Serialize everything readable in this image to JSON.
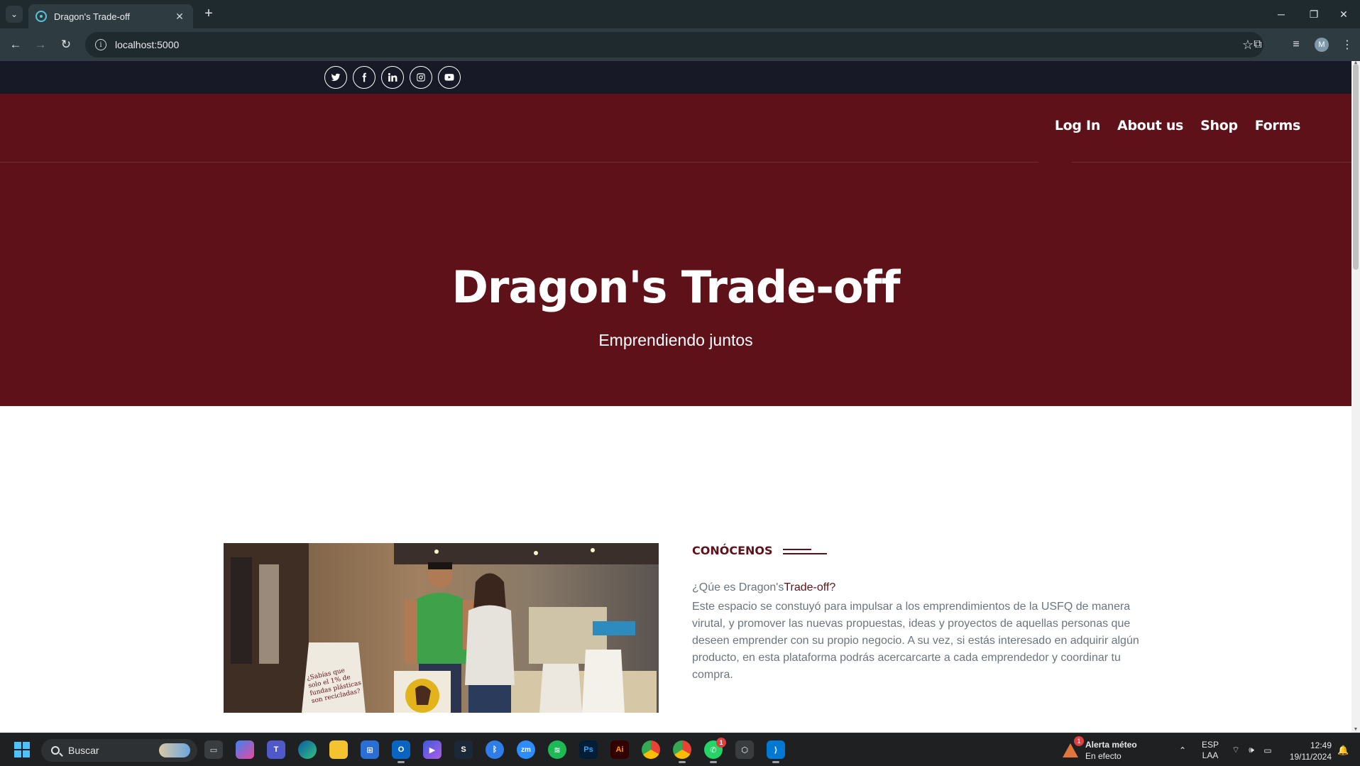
{
  "browser": {
    "tab_title": "Dragon's Trade-off",
    "new_tab": "+",
    "close_tab": "✕",
    "url": "localhost:5000",
    "window_controls": [
      "─",
      "❐",
      "✕"
    ],
    "profile_initial": "M"
  },
  "site": {
    "socials": [
      "twitter-icon",
      "facebook-icon",
      "linkedin-icon",
      "instagram-icon",
      "youtube-icon"
    ],
    "nav": [
      "Log In",
      "About us",
      "Shop",
      "Forms"
    ],
    "hero": {
      "title": "Dragon's Trade-off",
      "subtitle": "Emprendiendo juntos"
    },
    "about": {
      "section_title": "CONÓCENOS",
      "question_prefix": "¿Qúe es Dragon's",
      "question_highlight": "Trade-off?",
      "text": "Este espacio se constuyó para impulsar a los emprendimientos de la USFQ de manera virutal, y promover las nuevas propuestas, ideas y proyectos de aquellas personas que deseen emprender con su propio negocio. A su vez, si estás interesado en adquirir algún producto, en esta plataforma podrás acercarcarte a cada emprendedor y coordinar tu compra.",
      "image_text": "¿Sabías que solo el 1% de fundas plásticas son recicladas?"
    },
    "colors": {
      "brand": "#5e1119",
      "topbar": "#171a26"
    }
  },
  "taskbar": {
    "search_placeholder": "Buscar",
    "weather_title": "Alerta méteo",
    "weather_status": "En efecto",
    "weather_badge": "1",
    "whatsapp_badge": "1",
    "language": "ESP",
    "layout": "LAA",
    "time": "12:49",
    "date": "19/11/2024"
  }
}
